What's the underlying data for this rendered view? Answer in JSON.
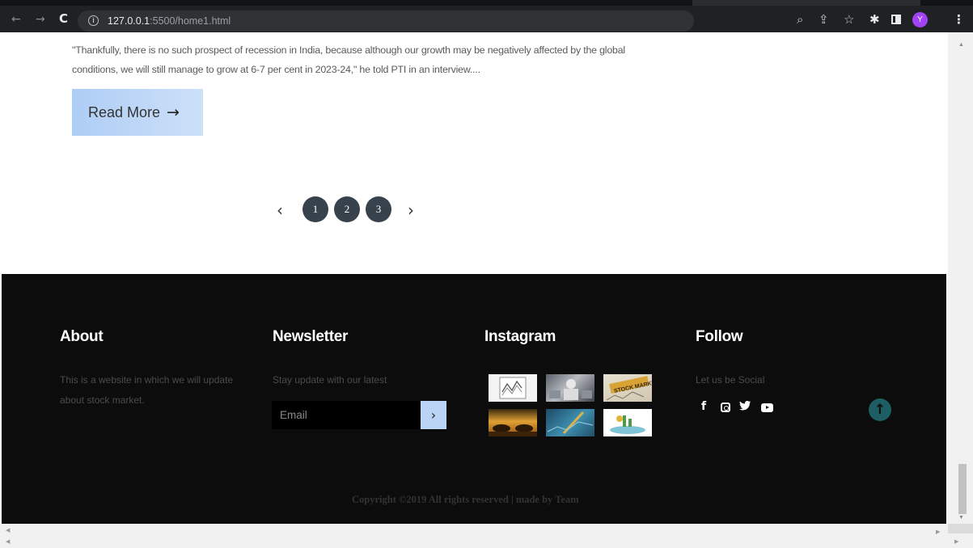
{
  "browser": {
    "url_host": "127.0.0.1",
    "url_rest": ":5500/home1.html",
    "avatar_letter": "Y",
    "icons": [
      "back-icon",
      "forward-icon",
      "reload-icon",
      "info-icon",
      "zoom-icon",
      "share-icon",
      "star-icon",
      "extensions-icon",
      "side-panel-icon",
      "menu-icon"
    ]
  },
  "article": {
    "excerpt": "\"Thankfully, there is no such prospect of recession in India, because although our growth may be negatively affected by the global conditions, we will still manage to grow at 6-7 per cent in 2023-24,\" he told PTI in an interview....",
    "read_more_label": "Read More",
    "read_more_arrow": "→"
  },
  "pagination": {
    "prev": "‹",
    "next": "›",
    "pages": [
      "1",
      "2",
      "3"
    ]
  },
  "footer": {
    "about": {
      "title": "About",
      "text": "This is a website in which we will update about stock market."
    },
    "newsletter": {
      "title": "Newsletter",
      "text": "Stay update with our latest",
      "email_placeholder": "Email",
      "submit_icon": "›"
    },
    "instagram": {
      "title": "Instagram",
      "thumbnails": [
        "chart-thumbnail",
        "trader-thumbnail",
        "stock-market-sign-thumbnail",
        "bull-bear-thumbnail",
        "pen-chart-thumbnail",
        "growth-thumbnail"
      ]
    },
    "follow": {
      "title": "Follow",
      "text": "Let us be Social",
      "social_icons": [
        "facebook-icon",
        "instagram-icon",
        "twitter-icon",
        "youtube-icon"
      ]
    },
    "back_to_top_icon": "↑",
    "copyright": "Copyright ©2019 All rights reserved | made by Team"
  },
  "colors": {
    "footer_bg": "#0c0c0c",
    "button_blue": "#b9d4f4",
    "pagination_dark": "#37424d",
    "to_top_teal": "#1d5d64"
  }
}
